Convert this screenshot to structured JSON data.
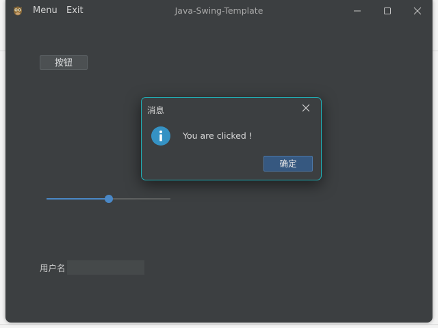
{
  "window": {
    "title": "Java-Swing-Template",
    "menus": [
      "Menu",
      "Exit"
    ]
  },
  "content": {
    "button_label": "按钮",
    "slider": {
      "min": 0,
      "max": 100,
      "value": 50
    },
    "username_label": "用户名",
    "username_value": "",
    "username_placeholder": ""
  },
  "dialog": {
    "title": "消息",
    "message": "You are clicked !",
    "ok_label": "确定",
    "icon": "information-icon"
  },
  "colors": {
    "window_bg": "#3c3f41",
    "accent": "#4a88c7",
    "dialog_border": "#1fb3ba",
    "ok_button": "#365880"
  }
}
